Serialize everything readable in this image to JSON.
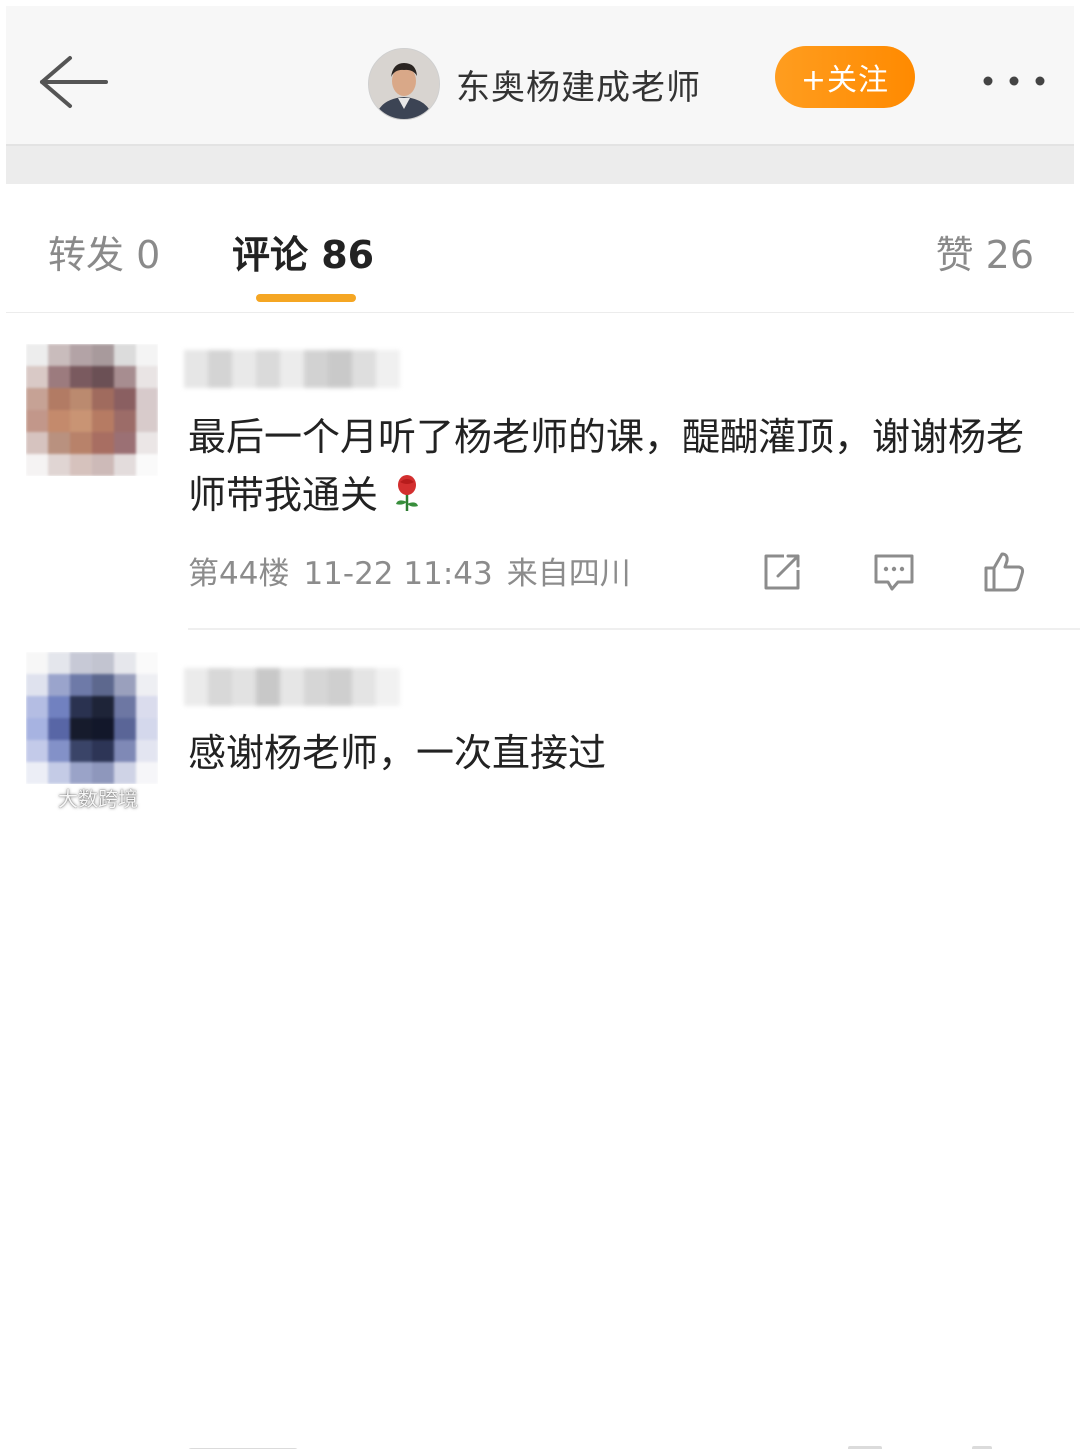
{
  "header": {
    "author_name": "东奥杨建成老师",
    "follow_label": "+关注",
    "colors": {
      "follow_bg": "#ff9100",
      "header_bg": "#f7f7f7"
    }
  },
  "tabs": {
    "repost_label": "转发 0",
    "comments_label": "评论 86",
    "likes_label": "赞 26",
    "active": "comments",
    "indicator_color": "#f5a623"
  },
  "comments": [
    {
      "text": "最后一个月听了杨老师的课，醍醐灌顶，谢谢杨老师带我通关",
      "emoji": "rose-icon",
      "floor": "第44楼",
      "timestamp": "11-22 11:43",
      "location": "来自四川",
      "actions": [
        "share-icon",
        "reply-icon",
        "like-icon"
      ]
    },
    {
      "text": "感谢杨老师，一次直接过"
    }
  ],
  "watermark": {
    "text": "大数跨境"
  }
}
